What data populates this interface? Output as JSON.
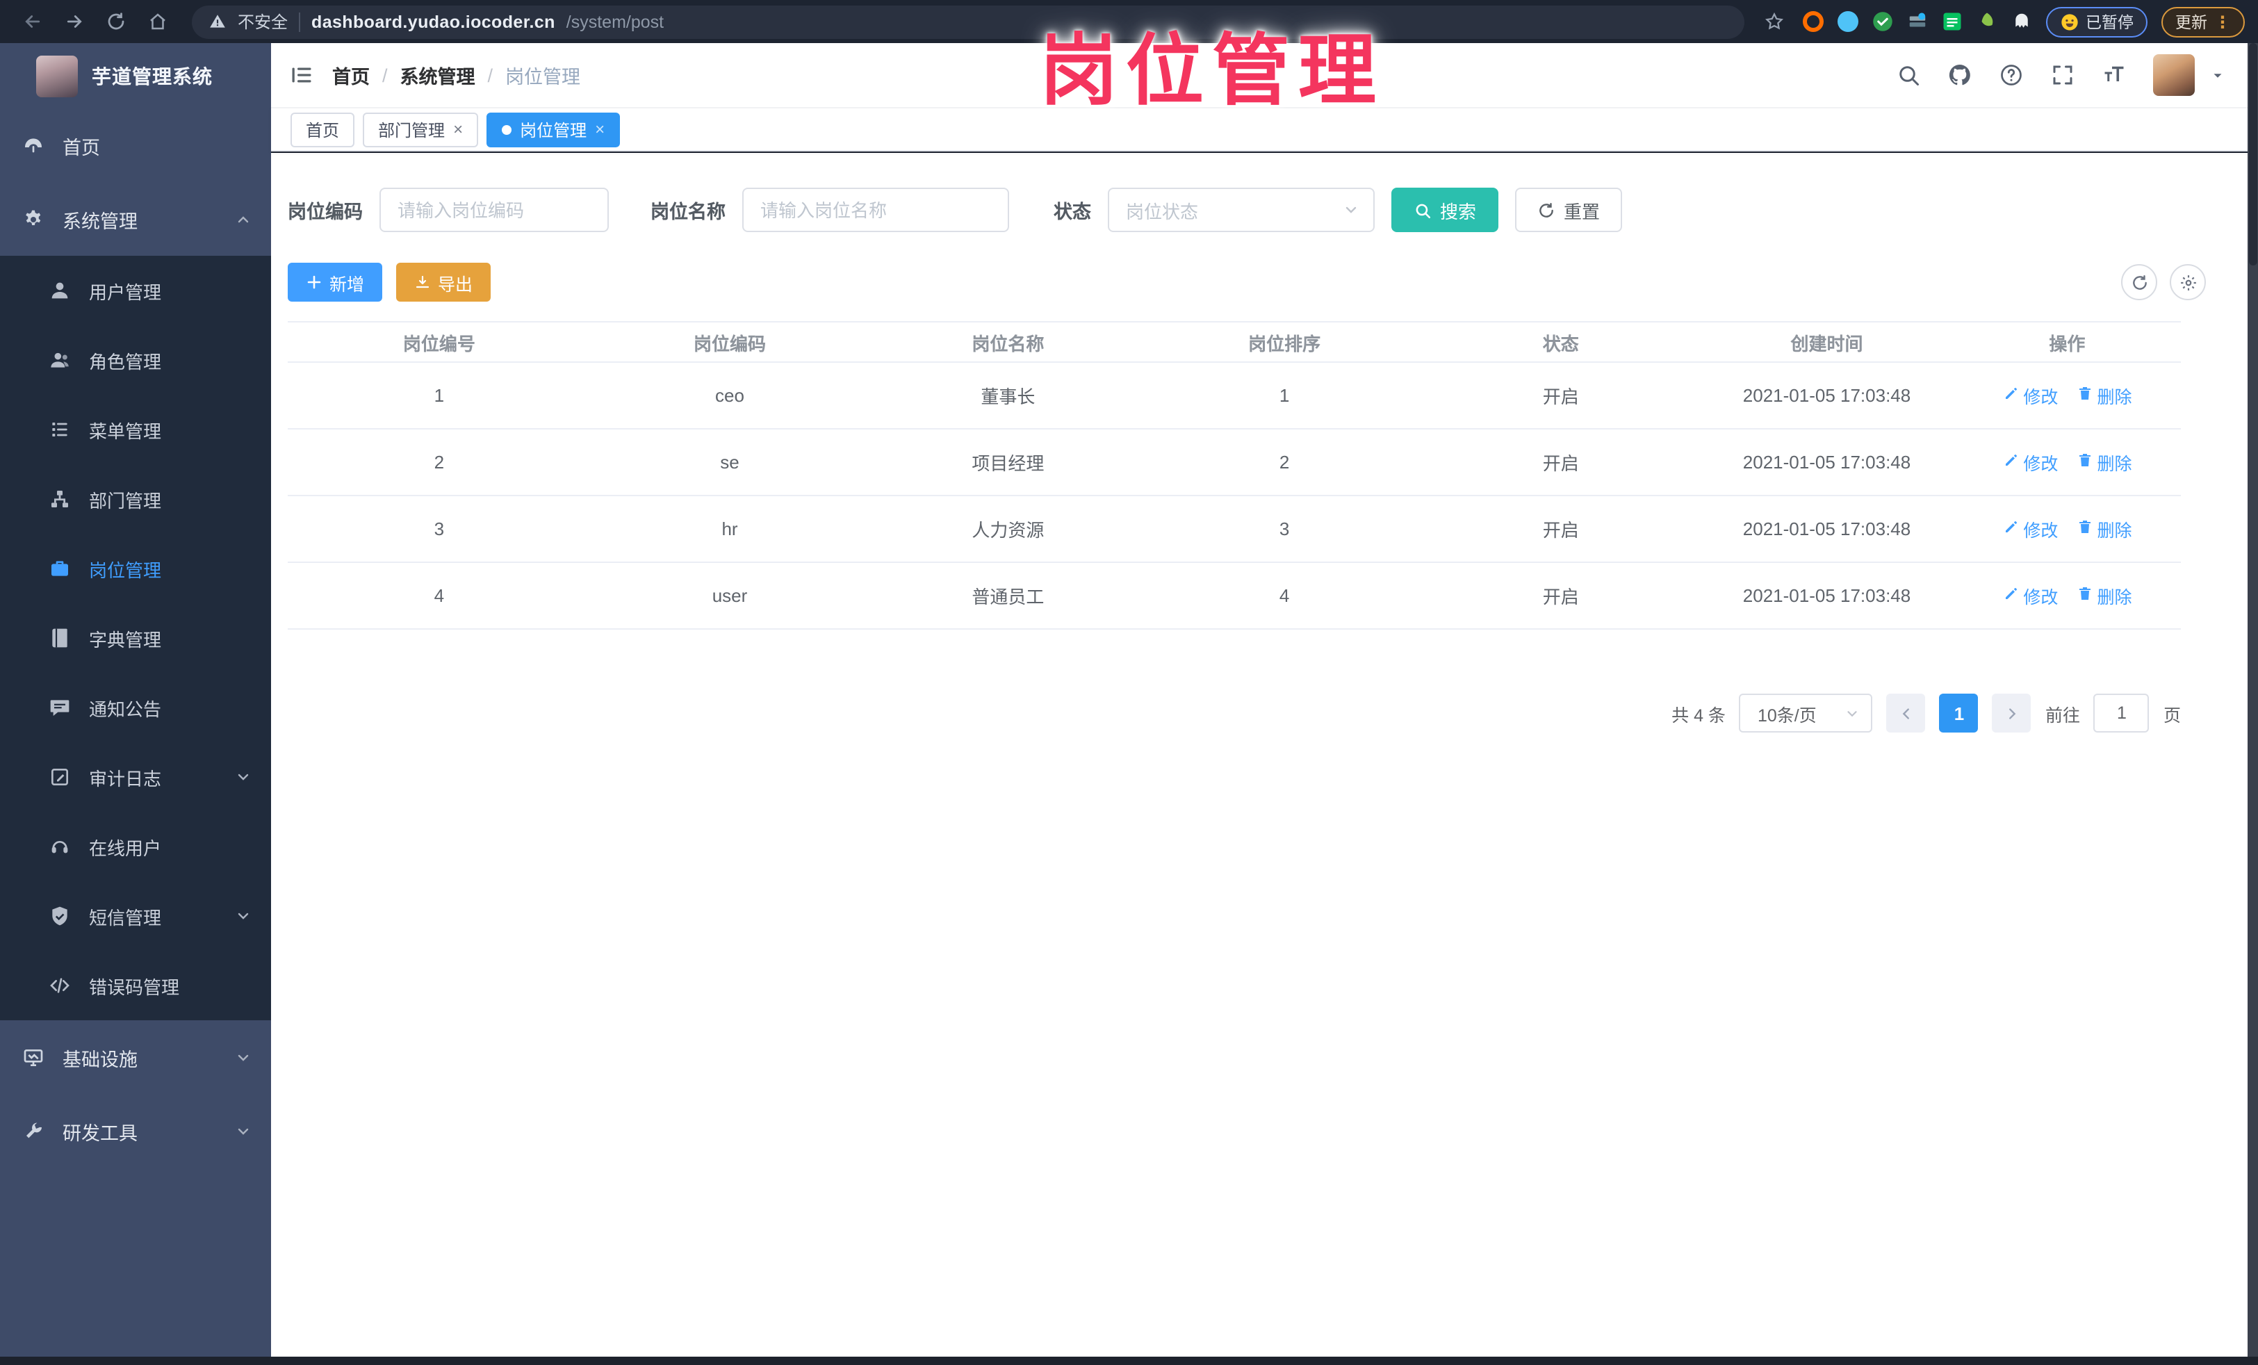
{
  "browser": {
    "security_label": "不安全",
    "url_host": "dashboard.yudao.iocoder.cn",
    "url_path": "/system/post",
    "paused_badge": "已暂停",
    "update_button": "更新"
  },
  "overlay_title": "岗位管理",
  "sidebar": {
    "logo_title": "芋道管理系统",
    "menu": [
      {
        "name": "home",
        "label": "首页",
        "icon": "dashboard-icon"
      },
      {
        "name": "system",
        "label": "系统管理",
        "icon": "gear-icon",
        "chevron": "up",
        "children": [
          {
            "name": "user-mgmt",
            "label": "用户管理",
            "icon": "user-icon"
          },
          {
            "name": "role-mgmt",
            "label": "角色管理",
            "icon": "role-icon"
          },
          {
            "name": "menu-mgmt",
            "label": "菜单管理",
            "icon": "list-icon"
          },
          {
            "name": "dept-mgmt",
            "label": "部门管理",
            "icon": "tree-icon"
          },
          {
            "name": "post-mgmt",
            "label": "岗位管理",
            "icon": "briefcase-icon",
            "active": true
          },
          {
            "name": "dict-mgmt",
            "label": "字典管理",
            "icon": "book-icon"
          },
          {
            "name": "notice",
            "label": "通知公告",
            "icon": "message-icon"
          },
          {
            "name": "audit-log",
            "label": "审计日志",
            "icon": "edit-icon",
            "chevron": "down"
          },
          {
            "name": "online-users",
            "label": "在线用户",
            "icon": "headset-icon"
          },
          {
            "name": "sms-mgmt",
            "label": "短信管理",
            "icon": "shield-icon",
            "chevron": "down"
          },
          {
            "name": "error-code",
            "label": "错误码管理",
            "icon": "code-icon"
          }
        ]
      },
      {
        "name": "infra",
        "label": "基础设施",
        "icon": "monitor-icon",
        "chevron": "down"
      },
      {
        "name": "dev-tools",
        "label": "研发工具",
        "icon": "toolbox-icon",
        "chevron": "down"
      }
    ]
  },
  "header": {
    "breadcrumb": [
      "首页",
      "系统管理",
      "岗位管理"
    ]
  },
  "tabs": [
    {
      "label": "首页",
      "closable": false,
      "active": false
    },
    {
      "label": "部门管理",
      "closable": true,
      "active": false
    },
    {
      "label": "岗位管理",
      "closable": true,
      "active": true
    }
  ],
  "filters": {
    "post_code_label": "岗位编码",
    "post_code_placeholder": "请输入岗位编码",
    "post_name_label": "岗位名称",
    "post_name_placeholder": "请输入岗位名称",
    "status_label": "状态",
    "status_placeholder": "岗位状态",
    "search_label": "搜索",
    "reset_label": "重置"
  },
  "toolbar": {
    "add_label": "新增",
    "export_label": "导出"
  },
  "table": {
    "headers": [
      "岗位编号",
      "岗位编码",
      "岗位名称",
      "岗位排序",
      "状态",
      "创建时间",
      "操作"
    ],
    "rows": [
      [
        "1",
        "ceo",
        "董事长",
        "1",
        "开启",
        "2021-01-05 17:03:48"
      ],
      [
        "2",
        "se",
        "项目经理",
        "2",
        "开启",
        "2021-01-05 17:03:48"
      ],
      [
        "3",
        "hr",
        "人力资源",
        "3",
        "开启",
        "2021-01-05 17:03:48"
      ],
      [
        "4",
        "user",
        "普通员工",
        "4",
        "开启",
        "2021-01-05 17:03:48"
      ]
    ],
    "edit_label": "修改",
    "delete_label": "删除"
  },
  "pagination": {
    "total_text": "共 4 条",
    "page_size": "10条/页",
    "current_page": "1",
    "goto_label": "前往",
    "goto_value": "1",
    "page_unit": "页"
  },
  "colors": {
    "accent": "#409EFF",
    "search_button": "#2BBFAE",
    "export_button": "#E6A23C",
    "overlay_title": "#F4355E",
    "sidebar": "#3E4B68",
    "submenu": "#202B3C"
  }
}
